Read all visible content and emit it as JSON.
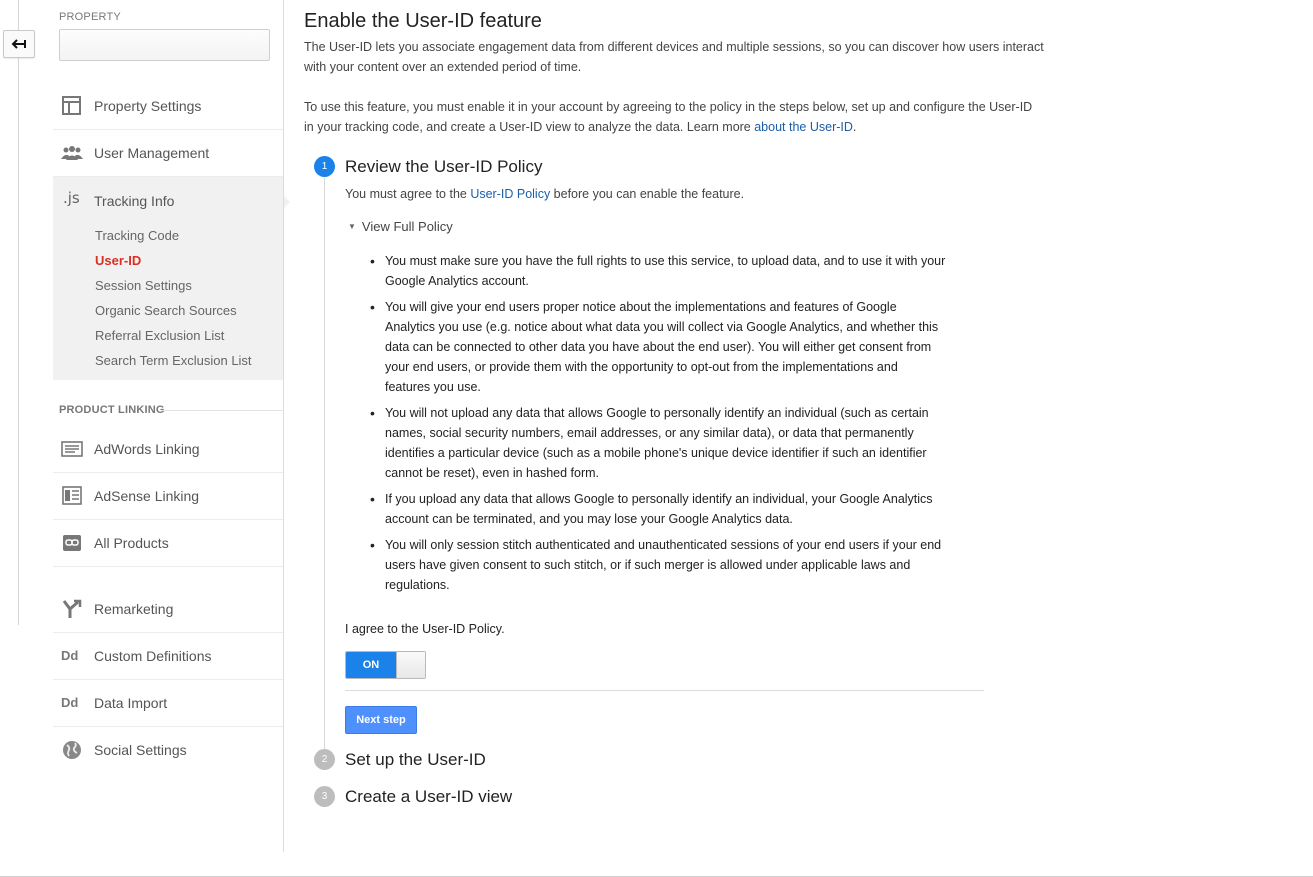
{
  "sidebar": {
    "property_label": "PROPERTY",
    "property_value": "",
    "items_top": [
      {
        "label": "Property Settings",
        "icon": "property-settings-icon"
      },
      {
        "label": "User Management",
        "icon": "users-icon"
      }
    ],
    "tracking": {
      "label": "Tracking Info",
      "icon_glyph": ".js",
      "subitems": [
        {
          "label": "Tracking Code"
        },
        {
          "label": "User-ID"
        },
        {
          "label": "Session Settings"
        },
        {
          "label": "Organic Search Sources"
        },
        {
          "label": "Referral Exclusion List"
        },
        {
          "label": "Search Term Exclusion List"
        }
      ]
    },
    "product_linking_label": "PRODUCT LINKING",
    "items_linking": [
      {
        "label": "AdWords Linking",
        "icon": "adwords-icon"
      },
      {
        "label": "AdSense Linking",
        "icon": "adsense-icon"
      },
      {
        "label": "All Products",
        "icon": "link-icon"
      }
    ],
    "items_bottom": [
      {
        "label": "Remarketing",
        "icon": "remarketing-icon"
      },
      {
        "label": "Custom Definitions",
        "icon_glyph": "Dd"
      },
      {
        "label": "Data Import",
        "icon_glyph": "Dd"
      },
      {
        "label": "Social Settings",
        "icon": "globe-icon"
      }
    ]
  },
  "main": {
    "title": "Enable the User-ID feature",
    "intro": "The User-ID lets you associate engagement data from different devices and multiple sessions, so you can discover how users interact with your content over an extended period of time.",
    "usage_text": "To use this feature, you must enable it in your account by agreeing to the policy in the steps below, set up and configure the User-ID in your tracking code, and create a User-ID view to analyze the data. Learn more ",
    "usage_link": "about the User-ID",
    "usage_end": ".",
    "step1": {
      "number": "1",
      "title": "Review the User-ID Policy",
      "desc_before": "You must agree to the ",
      "desc_link": "User-ID Policy",
      "desc_after": " before you can enable the feature.",
      "view_policy": "View Full Policy",
      "policy_items": [
        "You must make sure you have the full rights to use this service, to upload data, and to use it with your Google Analytics account.",
        "You will give your end users proper notice about the implementations and features of Google Analytics you use (e.g. notice about what data you will collect via Google Analytics, and whether this data can be connected to other data you have about the end user). You will either get consent from your end users, or provide them with the opportunity to opt-out from the implementations and features you use.",
        "You will not upload any data that allows Google to personally identify an individual (such as certain names, social security numbers, email addresses, or any similar data), or data that permanently identifies a particular device (such as a mobile phone's unique device identifier if such an identifier cannot be reset), even in hashed form.",
        "If you upload any data that allows Google to personally identify an individual, your Google Analytics account can be terminated, and you may lose your Google Analytics data.",
        "You will only session stitch authenticated and unauthenticated sessions of your end users if your end users have given consent to such stitch, or if such merger is allowed under applicable laws and regulations."
      ],
      "agree_label": "I agree to the User-ID Policy.",
      "toggle_state": "ON",
      "next_button": "Next step"
    },
    "step2": {
      "number": "2",
      "title": "Set up the User-ID"
    },
    "step3": {
      "number": "3",
      "title": "Create a User-ID view"
    }
  },
  "colors": {
    "accent_blue": "#1a82e8",
    "button_blue": "#4d90fe",
    "active_red": "#d93025",
    "link_blue": "#1a5fa8",
    "inactive_step": "#bdbdbd"
  }
}
